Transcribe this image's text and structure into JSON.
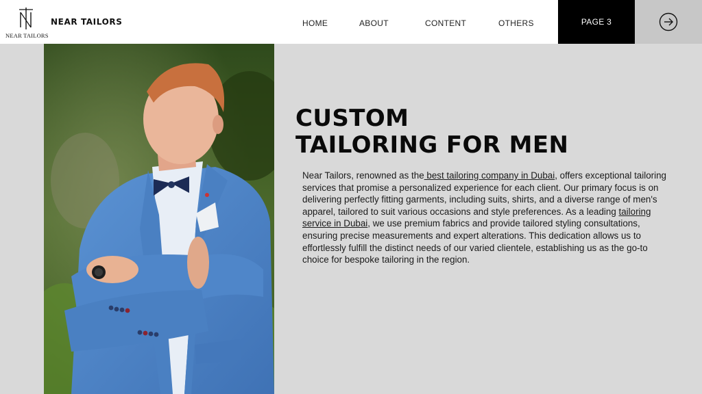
{
  "header": {
    "logo_monogram": "NT",
    "logo_caption": "NEAR TAILORS",
    "brand": "NEAR TAILORS",
    "nav": [
      {
        "label": "HOME"
      },
      {
        "label": "ABOUT"
      },
      {
        "label": "CONTENT"
      },
      {
        "label": "OTHERS"
      }
    ],
    "page_label": "PAGE 3",
    "next_icon": "arrow-right-circle-icon"
  },
  "main": {
    "title_line1": "CUSTOM",
    "title_line2": "TAILORING FOR MEN",
    "paragraph": {
      "part1": "Near Tailors, renowned as the",
      "link1": " best tailoring company in Dubai",
      "part2": ", offers exceptional tailoring services that promise a personalized experience for each client. Our primary focus is on delivering perfectly fitting garments, including suits, shirts, and a diverse range of men's apparel, tailored to suit various occasions and style preferences. As a leading ",
      "link2": "tailoring service in Dubai",
      "part3": ", we use premium fabrics and provide tailored styling consultations, ensuring precise measurements and expert alterations. This dedication allows us to effortlessly fulfill the distinct needs of our varied clientele, establishing us as the go-to choice for bespoke tailoring in the region."
    }
  },
  "colors": {
    "background": "#d9d9d9",
    "header": "#ffffff",
    "page_box": "#000000",
    "arrow_box": "#c7c7c7",
    "suit": "#4f86c9"
  }
}
